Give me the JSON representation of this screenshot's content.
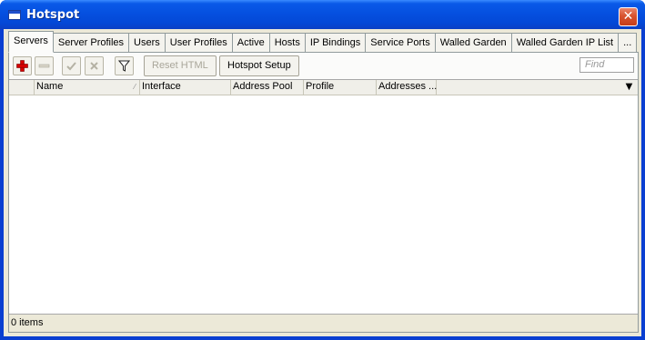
{
  "window": {
    "title": "Hotspot",
    "close_glyph": "✕"
  },
  "tabs": [
    {
      "label": "Servers",
      "active": true
    },
    {
      "label": "Server Profiles"
    },
    {
      "label": "Users"
    },
    {
      "label": "User Profiles"
    },
    {
      "label": "Active"
    },
    {
      "label": "Hosts"
    },
    {
      "label": "IP Bindings"
    },
    {
      "label": "Service Ports"
    },
    {
      "label": "Walled Garden"
    },
    {
      "label": "Walled Garden IP List"
    },
    {
      "label": "..."
    }
  ],
  "toolbar": {
    "add_icon": "plus-icon",
    "remove_icon": "minus-icon",
    "enable_icon": "check-icon",
    "disable_icon": "x-icon",
    "filter_icon": "filter-icon",
    "reset_html_label": "Reset HTML",
    "hotspot_setup_label": "Hotspot Setup",
    "find_placeholder": "Find"
  },
  "table": {
    "columns": [
      "Name",
      "Interface",
      "Address Pool",
      "Profile",
      "Addresses ..."
    ],
    "rows": []
  },
  "status": {
    "items": "0 items"
  }
}
